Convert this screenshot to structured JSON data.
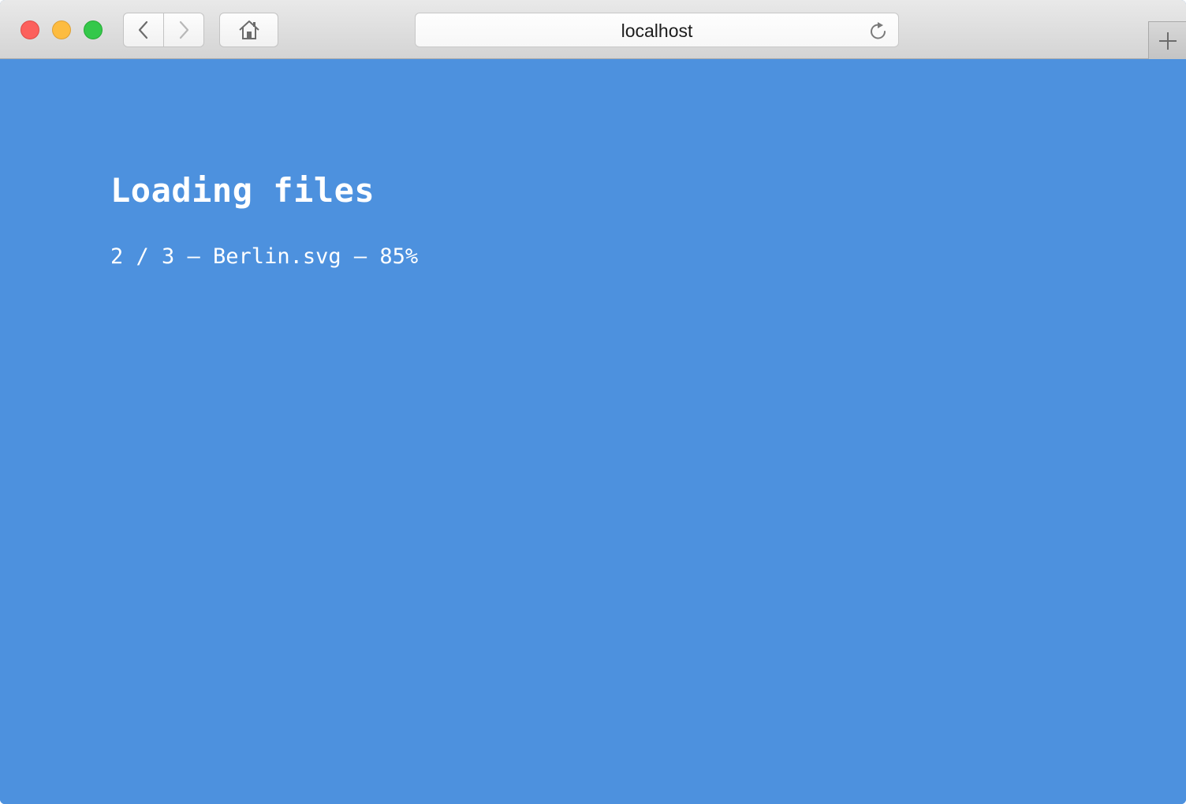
{
  "browser": {
    "url": "localhost",
    "icons": {
      "back": "chevron-left-icon",
      "forward": "chevron-right-icon",
      "home": "home-icon",
      "reload": "reload-icon",
      "new_tab": "plus-icon"
    },
    "traffic_lights": {
      "close": "#fc605c",
      "minimize": "#fdbc40",
      "maximize": "#34c84a"
    }
  },
  "page": {
    "background": "#4d91de",
    "title": "Loading files",
    "progress": {
      "current": 2,
      "total": 3,
      "file": "Berlin.svg",
      "percent": 85,
      "text": "2 / 3 — Berlin.svg — 85%"
    }
  }
}
